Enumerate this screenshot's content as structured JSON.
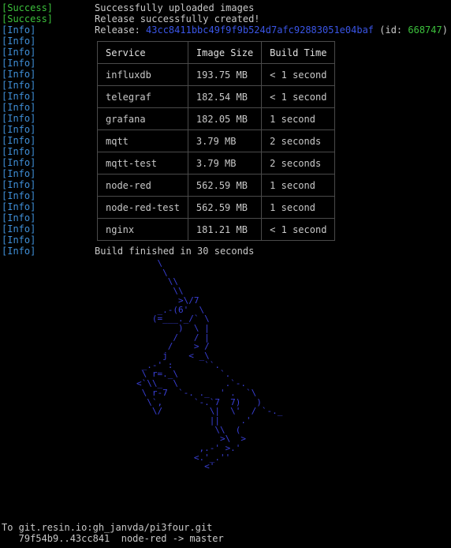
{
  "log": {
    "success_lines": [
      {
        "tag": "[Success]",
        "text": "Successfully uploaded images"
      },
      {
        "tag": "[Success]",
        "text": "Release successfully created!"
      }
    ],
    "release_tag": "[Info]",
    "release_label": "Release: ",
    "release_hash": "43cc8411bbc49f9f9b524d7afc92883051e04baf",
    "release_id_open": " (id: ",
    "release_id": "668747",
    "release_id_close": ")",
    "info_tag": "[Info]",
    "build_finished": "Build finished in 30 seconds",
    "colors": {
      "success": "#3cc03c",
      "info": "#3f8fd8",
      "hash": "#3a55e6",
      "ascii_art": "#3a40d8"
    }
  },
  "build_table": {
    "headers": [
      "Service",
      "Image Size",
      "Build Time"
    ],
    "rows": [
      [
        "influxdb",
        "193.75 MB",
        "< 1 second"
      ],
      [
        "telegraf",
        "182.54 MB",
        "< 1 second"
      ],
      [
        "grafana",
        "182.05 MB",
        "1 second"
      ],
      [
        "mqtt",
        "3.79 MB",
        "2 seconds"
      ],
      [
        "mqtt-test",
        "3.79 MB",
        "2 seconds"
      ],
      [
        "node-red",
        "562.59 MB",
        "1 second"
      ],
      [
        "node-red-test",
        "562.59 MB",
        "1 second"
      ],
      [
        "nginx",
        "181.21 MB",
        "< 1 second"
      ]
    ]
  },
  "unicorn_art": "            \\\n             \\\n              \\\\\n               \\\\\n                >\\/7\n            _.-(6'  \\\n           (=___._/` \\\n                )  \\ |\n               /   / |\n              /    > /\n             j    < _\\\n         _.-' :      ``.\n         \\ r=._\\        `.\n        <`\\\\_  \\         .`-.\n         \\ r-7  `-. ._  ' .  `\\\n          \\`,      `-.`7  7)   )\n           \\/         \\|  \\'  / `-._\n                      ||    .'\n                       \\\\  (\n                        >\\  >\n                    ,.-' >.'\n                   <.'_.''\n                     <'",
  "git": {
    "remote_line": "To git.resin.io:gh_janvda/pi3four.git",
    "ref_line": "   79f54b9..43cc841  node-red -> master"
  }
}
